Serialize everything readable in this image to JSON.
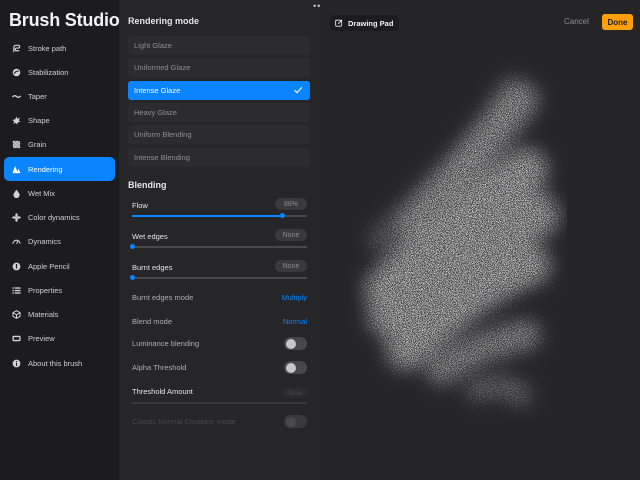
{
  "app": {
    "title": "Brush Studio",
    "more_glyph": "•••"
  },
  "sidebar": {
    "items": [
      {
        "label": "Stroke path",
        "icon": "stroke-path-icon"
      },
      {
        "label": "Stabilization",
        "icon": "stabilization-icon"
      },
      {
        "label": "Taper",
        "icon": "taper-icon"
      },
      {
        "label": "Shape",
        "icon": "shape-icon"
      },
      {
        "label": "Grain",
        "icon": "grain-icon"
      },
      {
        "label": "Rendering",
        "icon": "rendering-icon",
        "active": true
      },
      {
        "label": "Wet Mix",
        "icon": "wet-mix-icon"
      },
      {
        "label": "Color dynamics",
        "icon": "color-dynamics-icon"
      },
      {
        "label": "Dynamics",
        "icon": "dynamics-icon"
      },
      {
        "label": "Apple Pencil",
        "icon": "apple-pencil-icon"
      },
      {
        "label": "Properties",
        "icon": "properties-icon"
      },
      {
        "label": "Materials",
        "icon": "materials-icon"
      },
      {
        "label": "Preview",
        "icon": "preview-icon"
      },
      {
        "label": "About this brush",
        "icon": "info-icon"
      }
    ]
  },
  "rendering": {
    "title": "Rendering mode",
    "modes": [
      {
        "label": "Light Glaze"
      },
      {
        "label": "Uniformed Glaze"
      },
      {
        "label": "Intense Glaze",
        "selected": true
      },
      {
        "label": "Heavy Glaze"
      },
      {
        "label": "Uniform Blending"
      },
      {
        "label": "Intense Blending"
      }
    ]
  },
  "blending": {
    "title": "Blending",
    "flow": {
      "label": "Flow",
      "value": "86%",
      "level": 0.86
    },
    "wet_edges": {
      "label": "Wet edges",
      "value": "None",
      "level": 0
    },
    "burnt_edges": {
      "label": "Burnt edges",
      "value": "None",
      "level": 0
    },
    "burnt_edges_mode": {
      "label": "Burnt edges mode",
      "value": "Multiply"
    },
    "blend_mode": {
      "label": "Blend mode",
      "value": "Normal"
    },
    "luminance_blending": {
      "label": "Luminance blending",
      "on": false
    },
    "alpha_threshold": {
      "label": "Alpha Threshold",
      "on": false
    },
    "threshold_amount": {
      "label": "Threshold Amount",
      "value": "None"
    },
    "classic_normal": {
      "label": "Classic Normal Combine mode",
      "on": false,
      "disabled": true
    }
  },
  "canvas": {
    "pad_label": "Drawing Pad",
    "cancel_label": "Cancel",
    "done_label": "Done"
  },
  "colors": {
    "accent": "#0a84ff",
    "done": "#ff9f0a",
    "background": "#1c1c1e"
  }
}
